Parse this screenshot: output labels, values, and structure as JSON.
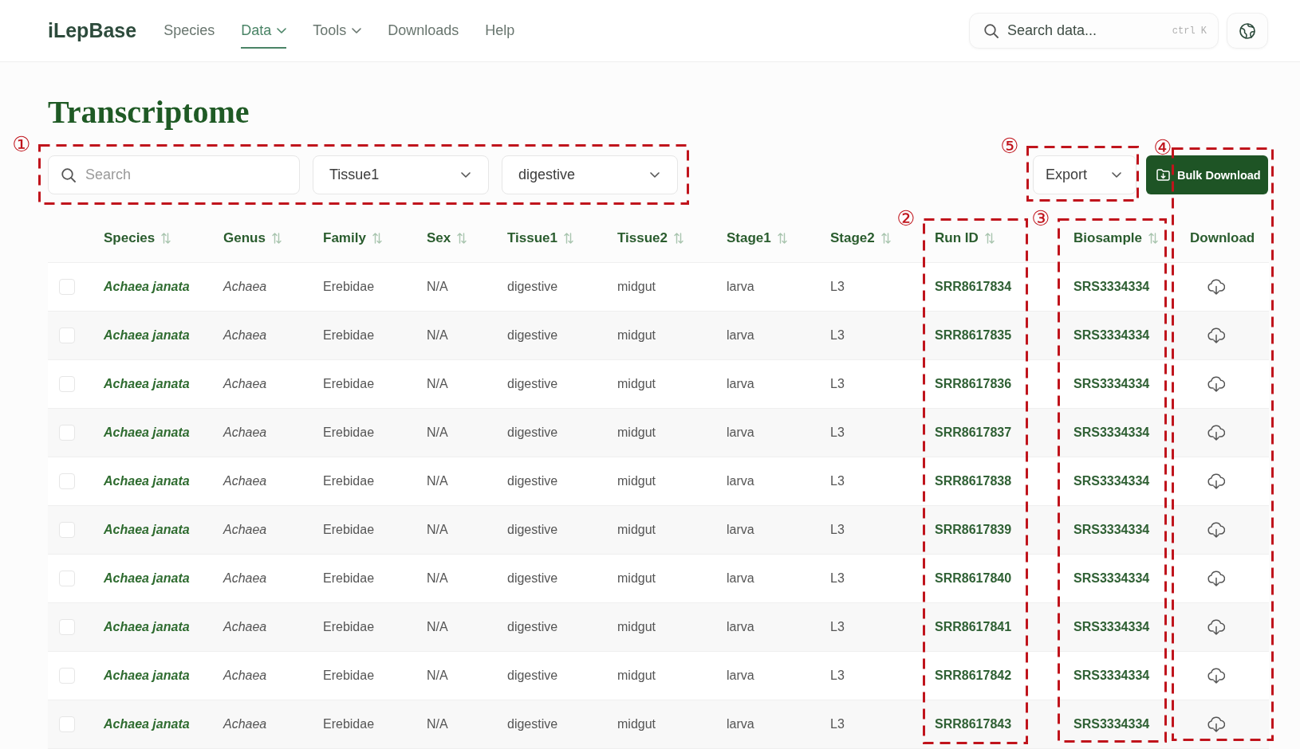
{
  "header": {
    "logo": "iLepBase",
    "nav": [
      {
        "label": "Species",
        "selected": false,
        "dropdown": false
      },
      {
        "label": "Data",
        "selected": true,
        "dropdown": true
      },
      {
        "label": "Tools",
        "selected": false,
        "dropdown": true
      },
      {
        "label": "Downloads",
        "selected": false,
        "dropdown": false
      },
      {
        "label": "Help",
        "selected": false,
        "dropdown": false
      }
    ],
    "search": {
      "placeholder": "Search data...",
      "shortcut": "ctrl K"
    }
  },
  "title": "Transcriptome",
  "toolbar": {
    "filters": {
      "annotation": "①",
      "search": {
        "placeholder": "Search"
      },
      "selects": [
        {
          "value": "Tissue1"
        },
        {
          "value": "digestive"
        }
      ]
    },
    "export": {
      "annotation": "⑤",
      "value": "Export"
    },
    "bulk_download": {
      "label": "Bulk Download"
    }
  },
  "table": {
    "columns": [
      {
        "label": "Species",
        "sortable": true
      },
      {
        "label": "Genus",
        "sortable": true
      },
      {
        "label": "Family",
        "sortable": true
      },
      {
        "label": "Sex",
        "sortable": true
      },
      {
        "label": "Tissue1",
        "sortable": true
      },
      {
        "label": "Tissue2",
        "sortable": true
      },
      {
        "label": "Stage1",
        "sortable": true
      },
      {
        "label": "Stage2",
        "sortable": true
      },
      {
        "label": "Run ID",
        "sortable": true,
        "annotation": "②"
      },
      {
        "label": "Biosample",
        "sortable": true,
        "annotation": "③"
      },
      {
        "label": "Download",
        "sortable": false,
        "annotation": "④"
      }
    ],
    "rows": [
      {
        "checked": false,
        "species": "Achaea janata",
        "genus": "Achaea",
        "family": "Erebidae",
        "sex": "N/A",
        "tissue1": "digestive",
        "tissue2": "midgut",
        "stage1": "larva",
        "stage2": "L3",
        "run_id": "SRR8617834",
        "biosample": "SRS3334334"
      },
      {
        "checked": false,
        "species": "Achaea janata",
        "genus": "Achaea",
        "family": "Erebidae",
        "sex": "N/A",
        "tissue1": "digestive",
        "tissue2": "midgut",
        "stage1": "larva",
        "stage2": "L3",
        "run_id": "SRR8617835",
        "biosample": "SRS3334334"
      },
      {
        "checked": false,
        "species": "Achaea janata",
        "genus": "Achaea",
        "family": "Erebidae",
        "sex": "N/A",
        "tissue1": "digestive",
        "tissue2": "midgut",
        "stage1": "larva",
        "stage2": "L3",
        "run_id": "SRR8617836",
        "biosample": "SRS3334334"
      },
      {
        "checked": false,
        "species": "Achaea janata",
        "genus": "Achaea",
        "family": "Erebidae",
        "sex": "N/A",
        "tissue1": "digestive",
        "tissue2": "midgut",
        "stage1": "larva",
        "stage2": "L3",
        "run_id": "SRR8617837",
        "biosample": "SRS3334334"
      },
      {
        "checked": false,
        "species": "Achaea janata",
        "genus": "Achaea",
        "family": "Erebidae",
        "sex": "N/A",
        "tissue1": "digestive",
        "tissue2": "midgut",
        "stage1": "larva",
        "stage2": "L3",
        "run_id": "SRR8617838",
        "biosample": "SRS3334334"
      },
      {
        "checked": false,
        "species": "Achaea janata",
        "genus": "Achaea",
        "family": "Erebidae",
        "sex": "N/A",
        "tissue1": "digestive",
        "tissue2": "midgut",
        "stage1": "larva",
        "stage2": "L3",
        "run_id": "SRR8617839",
        "biosample": "SRS3334334"
      },
      {
        "checked": false,
        "species": "Achaea janata",
        "genus": "Achaea",
        "family": "Erebidae",
        "sex": "N/A",
        "tissue1": "digestive",
        "tissue2": "midgut",
        "stage1": "larva",
        "stage2": "L3",
        "run_id": "SRR8617840",
        "biosample": "SRS3334334"
      },
      {
        "checked": false,
        "species": "Achaea janata",
        "genus": "Achaea",
        "family": "Erebidae",
        "sex": "N/A",
        "tissue1": "digestive",
        "tissue2": "midgut",
        "stage1": "larva",
        "stage2": "L3",
        "run_id": "SRR8617841",
        "biosample": "SRS3334334"
      },
      {
        "checked": false,
        "species": "Achaea janata",
        "genus": "Achaea",
        "family": "Erebidae",
        "sex": "N/A",
        "tissue1": "digestive",
        "tissue2": "midgut",
        "stage1": "larva",
        "stage2": "L3",
        "run_id": "SRR8617842",
        "biosample": "SRS3334334"
      },
      {
        "checked": false,
        "species": "Achaea janata",
        "genus": "Achaea",
        "family": "Erebidae",
        "sex": "N/A",
        "tissue1": "digestive",
        "tissue2": "midgut",
        "stage1": "larva",
        "stage2": "L3",
        "run_id": "SRR8617843",
        "biosample": "SRS3334334"
      }
    ]
  }
}
